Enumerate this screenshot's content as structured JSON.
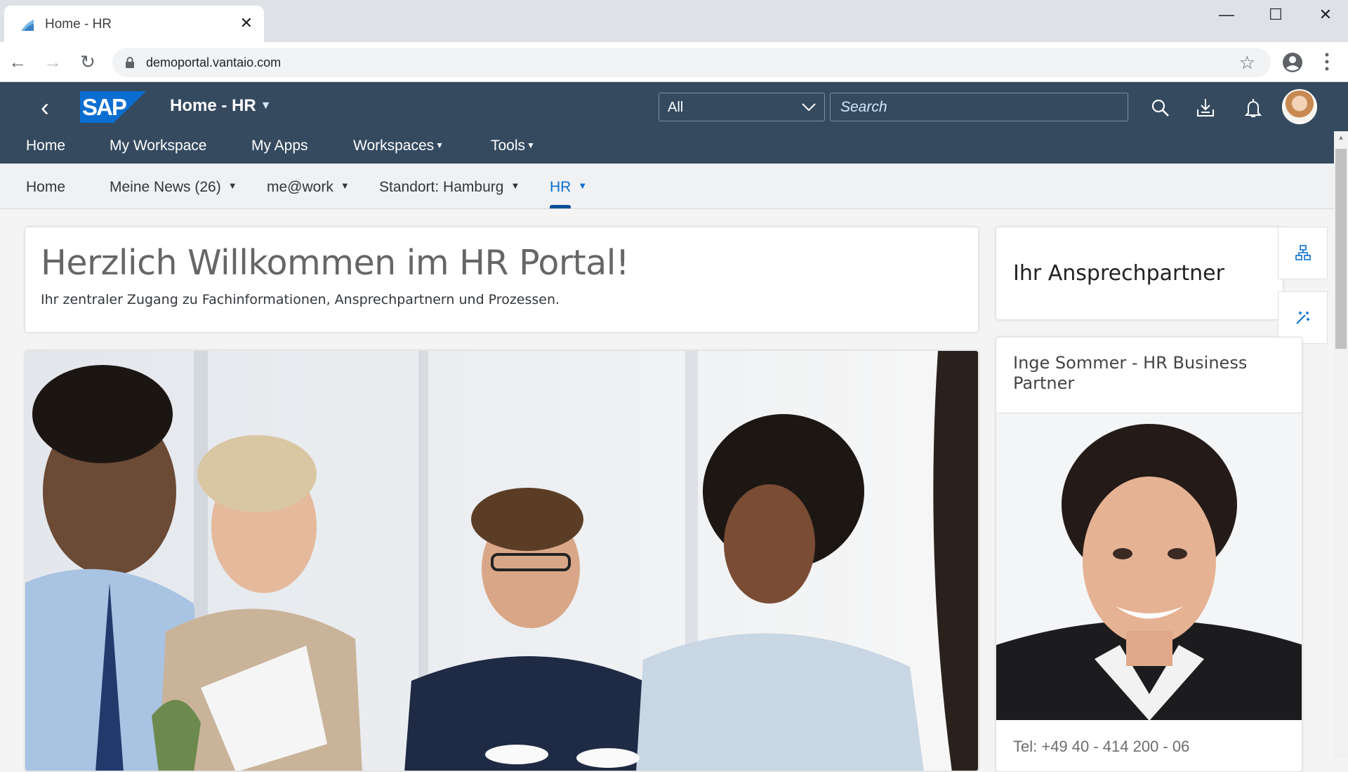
{
  "browser": {
    "tab_title": "Home - HR",
    "tab_close": "✕",
    "url": "demoportal.vantaio.com",
    "minimize": "—",
    "maximize": "☐",
    "close": "✕",
    "back": "←",
    "forward": "→",
    "reload": "↻",
    "star": "☆"
  },
  "shell": {
    "back_icon": "‹",
    "logo_text": "SAP",
    "title": "Home - HR",
    "title_caret": "▼",
    "scope_selected": "All",
    "search_placeholder": "Search",
    "brand_color": "#354a5f",
    "logo_color": "#0a6ed1"
  },
  "main_nav": {
    "items": [
      {
        "label": "Home",
        "has_menu": false
      },
      {
        "label": "My Workspace",
        "has_menu": false
      },
      {
        "label": "My Apps",
        "has_menu": false
      },
      {
        "label": "Workspaces",
        "has_menu": true
      },
      {
        "label": "Tools",
        "has_menu": true
      }
    ],
    "caret": "▼"
  },
  "sub_nav": {
    "items": [
      {
        "label": "Home",
        "has_menu": false
      },
      {
        "label": "Meine News (26)",
        "has_menu": true
      },
      {
        "label": "me@work",
        "has_menu": true
      },
      {
        "label": "Standort: Hamburg",
        "has_menu": true
      },
      {
        "label": "HR",
        "has_menu": true,
        "active": true
      }
    ],
    "caret": "▼",
    "active_color": "#0a6ed1"
  },
  "welcome": {
    "title": "Herzlich Willkommen im HR Portal!",
    "subtitle": "Ihr zentraler Zugang zu Fachinformationen, Ansprechpartnern und Prozessen."
  },
  "hero": {
    "image_description": "Team meeting photo with four colleagues at a table"
  },
  "contact": {
    "heading": "Ihr Ansprechpartner",
    "name": "Inge Sommer - HR Business Partner",
    "phone": "Tel: +49 40 - 414 200 - 06"
  },
  "side_actions": {
    "org_chart_icon": "org-chart",
    "magic_wand_icon": "magic-wand"
  }
}
